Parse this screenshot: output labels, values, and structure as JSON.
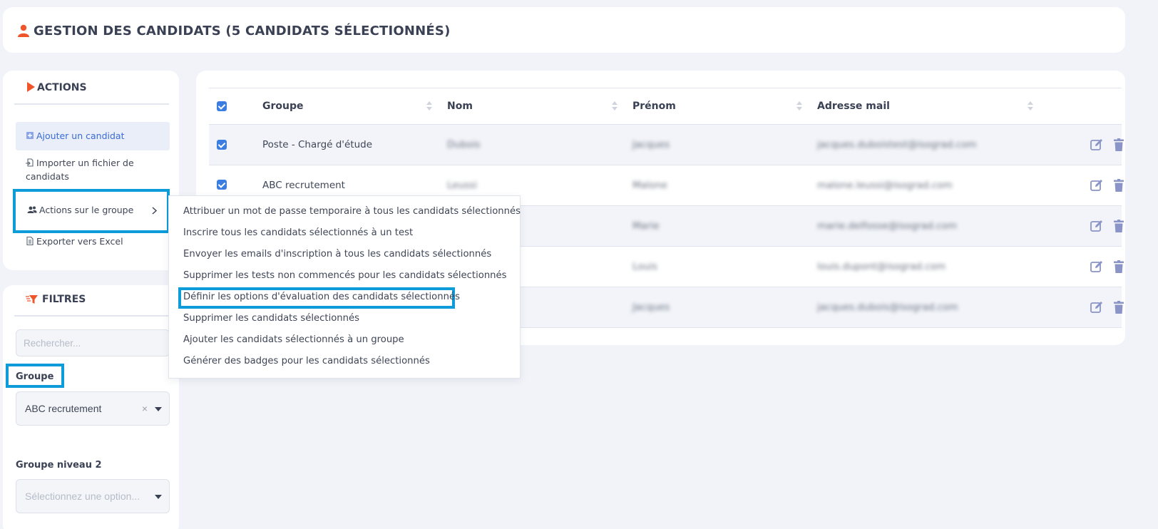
{
  "header": {
    "title": "GESTION DES CANDIDATS (5 CANDIDATS SÉLECTIONNÉS)",
    "icon": "user-icon"
  },
  "actions": {
    "title": "ACTIONS",
    "items": [
      {
        "label": "Ajouter un candidat",
        "icon": "plus-square-icon"
      },
      {
        "label": "Importer un fichier de candidats",
        "icon": "file-import-icon"
      },
      {
        "label": "Actions sur le groupe",
        "icon": "users-icon"
      },
      {
        "label": "Exporter vers Excel",
        "icon": "file-icon"
      }
    ]
  },
  "filters": {
    "title": "FILTRES",
    "search_placeholder": "Rechercher...",
    "group_label": "Groupe",
    "group_value": "ABC recrutement",
    "group2_label": "Groupe niveau 2",
    "group2_placeholder": "Sélectionnez une option..."
  },
  "table": {
    "columns": [
      "Groupe",
      "Nom",
      "Prénom",
      "Adresse mail"
    ],
    "rows": [
      {
        "groupe": "Poste - Chargé d'étude",
        "nom": "Dubois",
        "prenom": "Jacques",
        "email": "jacques.duboistest@isograd.com"
      },
      {
        "groupe": "ABC recrutement",
        "nom": "Leussi",
        "prenom": "Malone",
        "email": "malone.leussi@isograd.com"
      },
      {
        "groupe": "",
        "nom": "",
        "prenom": "Marie",
        "email": "marie.delfosse@isograd.com"
      },
      {
        "groupe": "",
        "nom": "",
        "prenom": "Louis",
        "email": "louis.dupont@isograd.com"
      },
      {
        "groupe": "",
        "nom": "",
        "prenom": "Jacques",
        "email": "jacques.dubois@isograd.com"
      }
    ]
  },
  "group_actions_menu": [
    "Attribuer un mot de passe temporaire à tous les candidats sélectionnés",
    "Inscrire tous les candidats sélectionnés à un test",
    "Envoyer les emails d'inscription à tous les candidats sélectionnés",
    "Supprimer les tests non commencés pour les candidats sélectionnés",
    "Définir les options d'évaluation des candidats sélectionnés",
    "Supprimer les candidats sélectionnés",
    "Ajouter les candidats sélectionnés à un groupe",
    "Générer des badges pour les candidats sélectionnés"
  ],
  "colors": {
    "accent": "#f0542a",
    "highlight": "#0d9bd9",
    "checkbox": "#3b7de0",
    "action_icon": "#8a94c6"
  }
}
